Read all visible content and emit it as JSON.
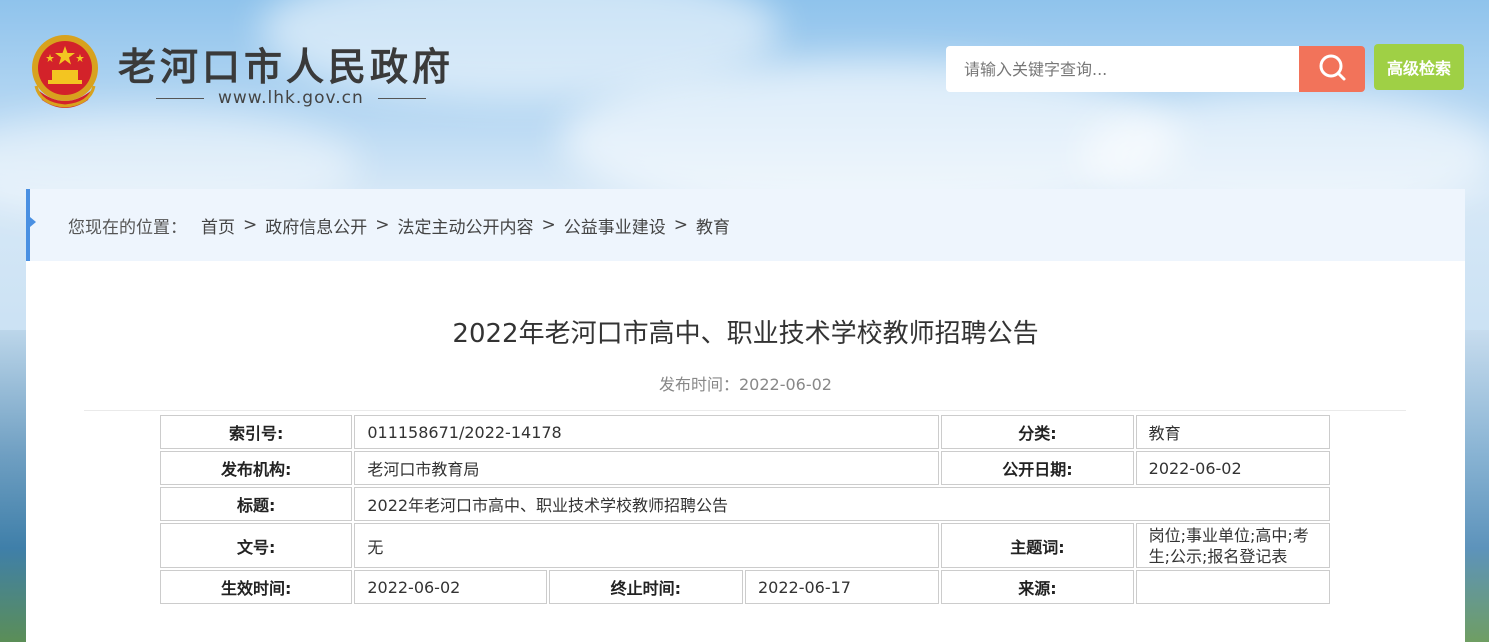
{
  "header": {
    "site_title": "老河口市人民政府",
    "site_url": "www.lhk.gov.cn",
    "search_placeholder": "请输入关键字查询...",
    "advanced_search_label": "高级检索"
  },
  "breadcrumb": {
    "prefix": "您现在的位置：",
    "items": [
      "首页",
      "政府信息公开",
      "法定主动公开内容",
      "公益事业建设",
      "教育"
    ],
    "separator": ">"
  },
  "article": {
    "title": "2022年老河口市高中、职业技术学校教师招聘公告",
    "publish_time": "发布时间：2022-06-02"
  },
  "meta": {
    "index_label": "索引号:",
    "index_value": "011158671/2022-14178",
    "category_label": "分类:",
    "category_value": "教育",
    "publisher_label": "发布机构:",
    "publisher_value": "老河口市教育局",
    "open_date_label": "公开日期:",
    "open_date_value": "2022-06-02",
    "title_label": "标题:",
    "title_value": "2022年老河口市高中、职业技术学校教师招聘公告",
    "doc_no_label": "文号:",
    "doc_no_value": "无",
    "keywords_label": "主题词:",
    "keywords_value": "岗位;事业单位;高中;考生;公示;报名登记表",
    "effective_label": "生效时间:",
    "effective_value": "2022-06-02",
    "end_label": "终止时间:",
    "end_value": "2022-06-17",
    "source_label": "来源:",
    "source_value": ""
  },
  "colors": {
    "search_button": "#f2735a",
    "advanced_button": "#9fd045",
    "breadcrumb_accent": "#4a90e2",
    "breadcrumb_bg": "#eef5fd"
  },
  "icons": {
    "emblem": "national-emblem-icon",
    "search": "search-icon"
  }
}
